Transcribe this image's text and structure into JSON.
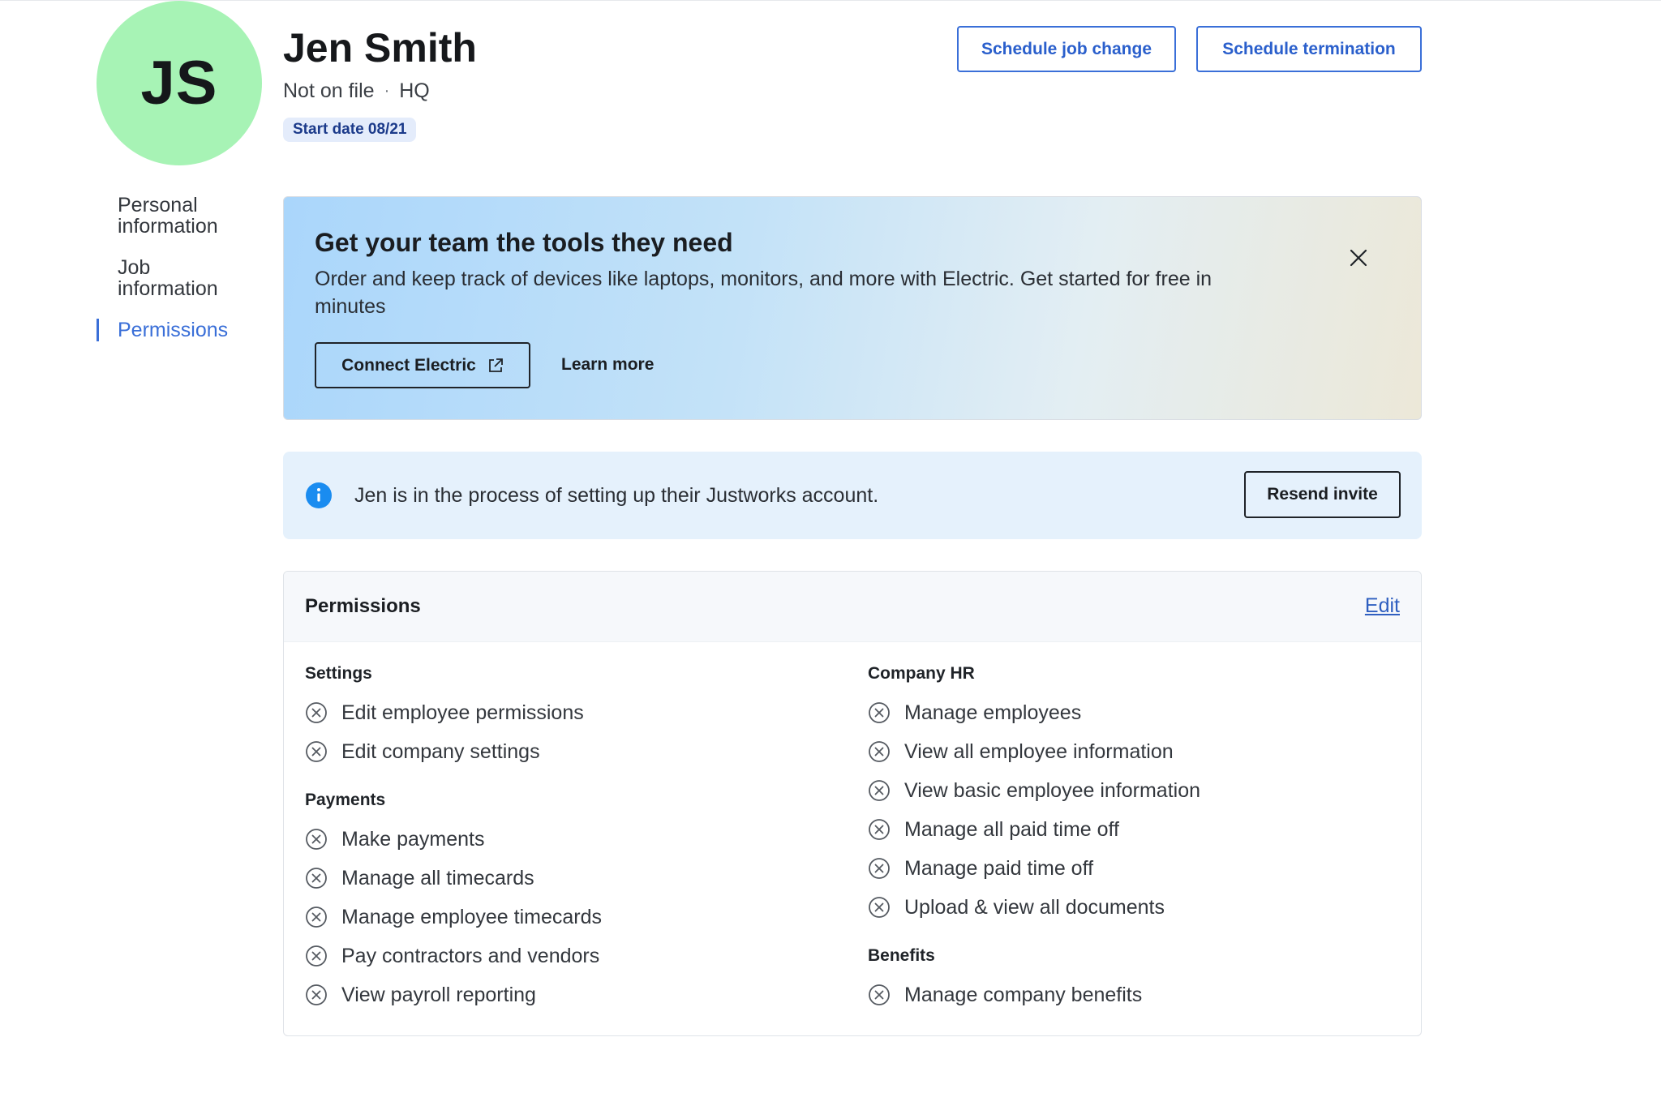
{
  "profile": {
    "initials": "JS",
    "name": "Jen Smith",
    "subtitle_left": "Not on file",
    "subtitle_separator": "·",
    "subtitle_right": "HQ",
    "start_badge": "Start date 08/21"
  },
  "header_actions": {
    "schedule_job_change": "Schedule job change",
    "schedule_termination": "Schedule termination"
  },
  "sidenav": {
    "items": [
      {
        "label_line1": "Personal",
        "label_line2": "information"
      },
      {
        "label_line1": "Job",
        "label_line2": "information"
      },
      {
        "label_line1": "Permissions",
        "label_line2": ""
      }
    ],
    "active": "Permissions"
  },
  "promo": {
    "title": "Get your team the tools they need",
    "text": "Order and keep track of devices like laptops, monitors, and more with Electric. Get started for free in minutes",
    "connect_label": "Connect Electric",
    "learn_more": "Learn more",
    "close_icon": "close-icon"
  },
  "info": {
    "icon": "info-icon",
    "text": "Jen is in the process of setting up their Justworks account.",
    "resend_label": "Resend invite",
    "accent_color": "#1a8cf0"
  },
  "permissions": {
    "title": "Permissions",
    "edit_label": "Edit",
    "left_groups": [
      {
        "title": "Settings",
        "items": [
          "Edit employee permissions",
          "Edit company settings"
        ]
      },
      {
        "title": "Payments",
        "items": [
          "Make payments",
          "Manage all timecards",
          "Manage employee timecards",
          "Pay contractors and vendors",
          "View payroll reporting"
        ]
      }
    ],
    "right_groups": [
      {
        "title": "Company HR",
        "items": [
          "Manage employees",
          "View all employee information",
          "View basic employee information",
          "Manage all paid time off",
          "Manage paid time off",
          "Upload & view all documents"
        ]
      },
      {
        "title": "Benefits",
        "items": [
          "Manage company benefits"
        ]
      }
    ]
  },
  "colors": {
    "avatar_bg": "#a7f3b5",
    "link_blue": "#3a6fd8",
    "info_bg": "#e5f1fc"
  }
}
